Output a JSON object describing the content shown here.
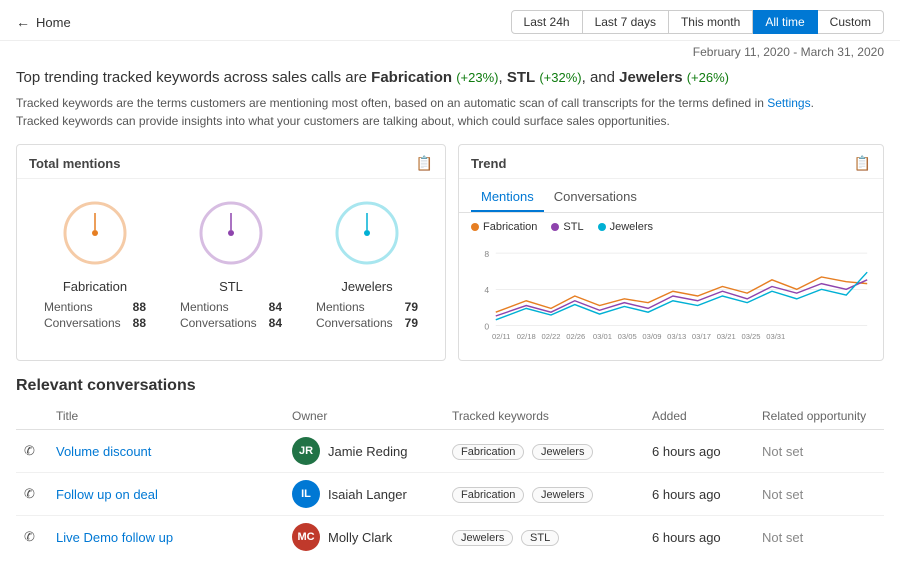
{
  "header": {
    "back_label": "Home",
    "time_filters": [
      {
        "id": "last24h",
        "label": "Last 24h",
        "active": false
      },
      {
        "id": "last7d",
        "label": "Last 7 days",
        "active": false
      },
      {
        "id": "thismonth",
        "label": "This month",
        "active": false
      },
      {
        "id": "alltime",
        "label": "All time",
        "active": true
      },
      {
        "id": "custom",
        "label": "Custom",
        "active": false
      }
    ]
  },
  "date_range": "February 11, 2020 - March 31, 2020",
  "headline": {
    "prefix": "Top trending tracked keywords across sales calls are",
    "keywords": [
      {
        "name": "Fabrication",
        "pct": "+23%"
      },
      {
        "name": "STL",
        "pct": "+32%"
      },
      {
        "name": "Jewelers",
        "pct": "+26%"
      }
    ],
    "description_line1": "Tracked keywords are the terms customers are mentioning most often, based on an automatic scan of call transcripts for the terms defined in",
    "settings_link": "Settings",
    "description_line2": "Tracked keywords can provide insights into what your customers are talking about, which could surface sales opportunities."
  },
  "total_mentions": {
    "title": "Total mentions",
    "items": [
      {
        "name": "Fabrication",
        "color": "#e67e22",
        "circle_color": "#e67e22",
        "mentions": 88,
        "conversations": 88,
        "radius_pct": 0.72
      },
      {
        "name": "STL",
        "color": "#8e44ad",
        "circle_color": "#8e44ad",
        "mentions": 84,
        "conversations": 84,
        "radius_pct": 0.68
      },
      {
        "name": "Jewelers",
        "color": "#00b0d4",
        "circle_color": "#00b0d4",
        "mentions": 79,
        "conversations": 79,
        "radius_pct": 0.64
      }
    ]
  },
  "trend": {
    "title": "Trend",
    "tabs": [
      "Mentions",
      "Conversations"
    ],
    "active_tab": "Mentions",
    "legend": [
      {
        "name": "Fabrication",
        "color": "#e67e22"
      },
      {
        "name": "STL",
        "color": "#8e44ad"
      },
      {
        "name": "Jewelers",
        "color": "#00b0d4"
      }
    ],
    "x_labels": [
      "02/11",
      "02/18",
      "02/22",
      "02/26",
      "03/01",
      "03/05",
      "03/09",
      "03/13",
      "03/17",
      "03/21",
      "03/25",
      "03/31"
    ],
    "y_labels": [
      "8",
      "4",
      "0"
    ]
  },
  "conversations": {
    "title": "Relevant conversations",
    "columns": [
      "Title",
      "Owner",
      "Tracked keywords",
      "Added",
      "Related opportunity"
    ],
    "rows": [
      {
        "phone": true,
        "title": "Volume discount",
        "owner_initials": "JR",
        "owner_name": "Jamie Reding",
        "owner_color": "#217346",
        "keywords": [
          "Fabrication",
          "Jewelers"
        ],
        "added": "6 hours ago",
        "opportunity": "Not set"
      },
      {
        "phone": true,
        "title": "Follow up on deal",
        "owner_initials": "IL",
        "owner_name": "Isaiah Langer",
        "owner_color": "#0078d4",
        "keywords": [
          "Fabrication",
          "Jewelers"
        ],
        "added": "6 hours ago",
        "opportunity": "Not set"
      },
      {
        "phone": true,
        "title": "Live Demo follow up",
        "owner_initials": "MC",
        "owner_name": "Molly Clark",
        "owner_color": "#c0392b",
        "keywords": [
          "Jewelers",
          "STL"
        ],
        "added": "6 hours ago",
        "opportunity": "Not set"
      }
    ]
  }
}
